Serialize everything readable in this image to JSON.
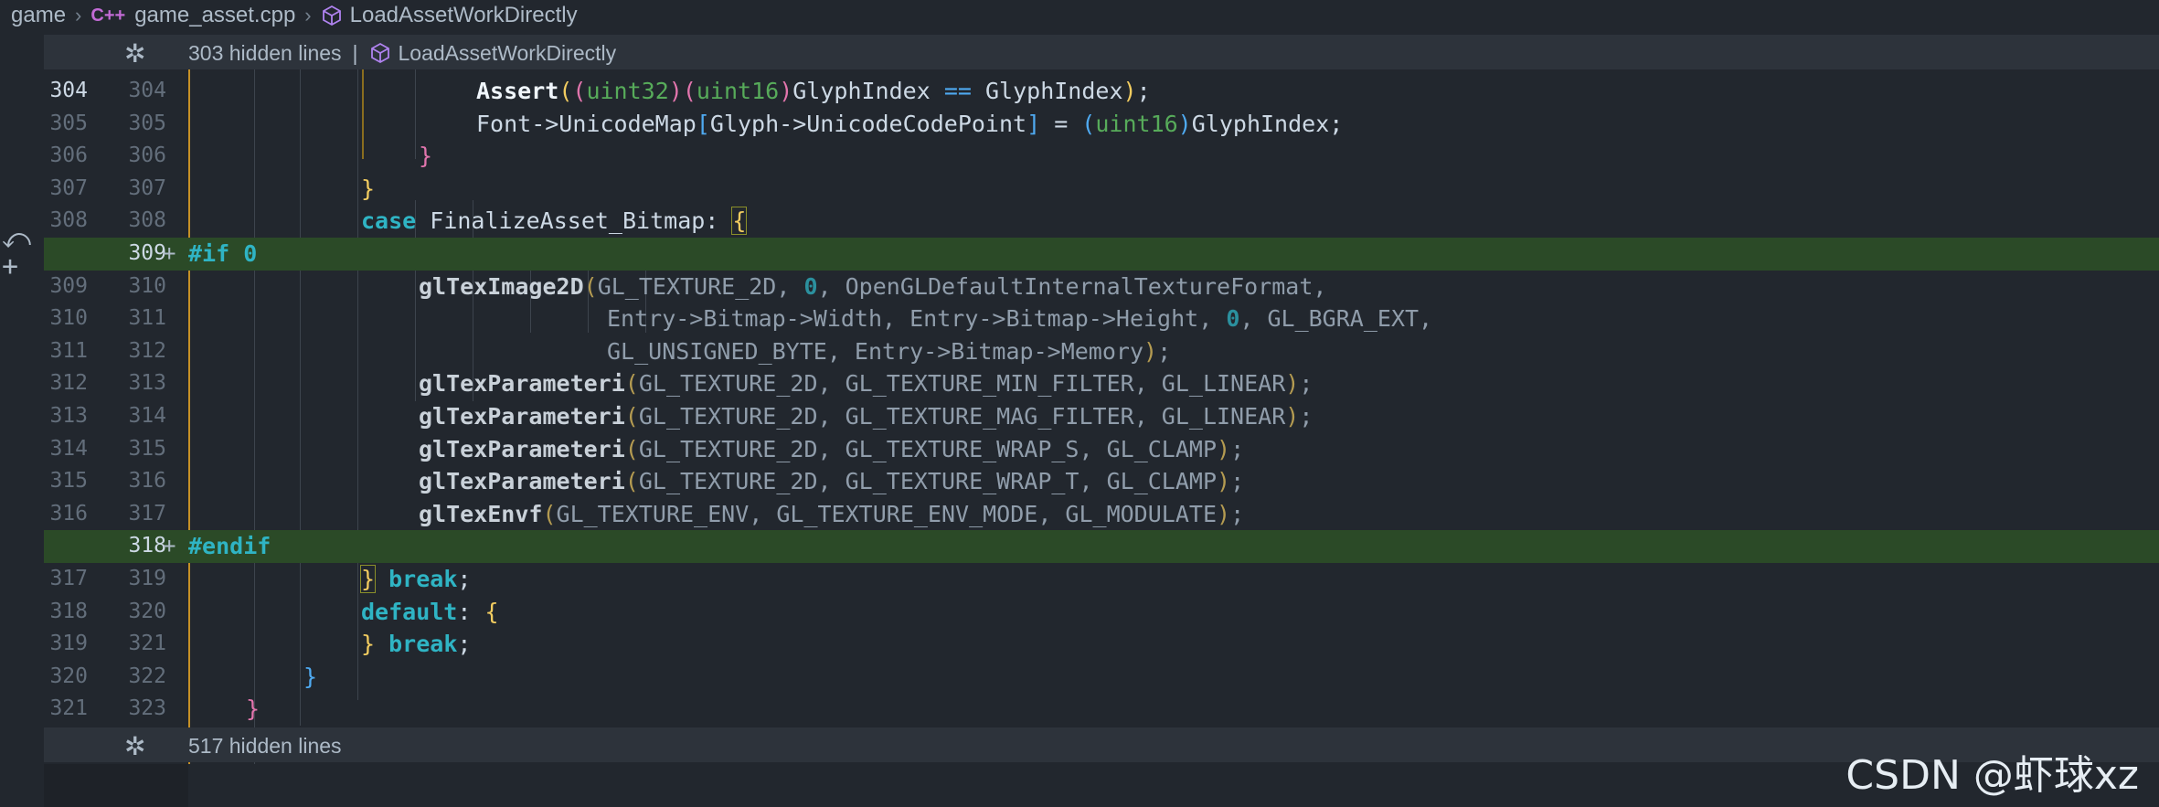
{
  "breadcrumb": {
    "items": [
      "game",
      "game_asset.cpp",
      "LoadAssetWorkDirectly"
    ],
    "file_badge": "C++"
  },
  "hidden_top": {
    "label": "303 hidden lines",
    "symbol": "LoadAssetWorkDirectly"
  },
  "hidden_bottom": {
    "label": "517 hidden lines"
  },
  "lines": [
    {
      "old": "304",
      "new": "304"
    },
    {
      "old": "305",
      "new": "305"
    },
    {
      "old": "306",
      "new": "306"
    },
    {
      "old": "307",
      "new": "307"
    },
    {
      "old": "308",
      "new": "308"
    },
    {
      "old": "",
      "new": "309",
      "added": true
    },
    {
      "old": "309",
      "new": "310"
    },
    {
      "old": "310",
      "new": "311"
    },
    {
      "old": "311",
      "new": "312"
    },
    {
      "old": "312",
      "new": "313"
    },
    {
      "old": "313",
      "new": "314"
    },
    {
      "old": "314",
      "new": "315"
    },
    {
      "old": "315",
      "new": "316"
    },
    {
      "old": "316",
      "new": "317"
    },
    {
      "old": "",
      "new": "318",
      "added": true
    },
    {
      "old": "317",
      "new": "319"
    },
    {
      "old": "318",
      "new": "320"
    },
    {
      "old": "319",
      "new": "321"
    },
    {
      "old": "320",
      "new": "322"
    },
    {
      "old": "321",
      "new": "323"
    }
  ],
  "code": {
    "l304": {
      "assert": "Assert",
      "p1": "(",
      "p2": "(",
      "t1": "uint32",
      "p3": ")",
      "p4": "(",
      "t2": "uint16",
      "p5": ")",
      "a": "GlyphIndex ",
      "eq": "==",
      "b": " GlyphIndex",
      "p6": ")",
      ";": ";"
    },
    "l305": {
      "a": "Font->UnicodeMap",
      "lb": "[",
      "b": "Glyph->UnicodeCodePoint",
      "rb": "]",
      "c": " = ",
      "p1": "(",
      "t": "uint16",
      "p2": ")",
      "d": "GlyphIndex;"
    },
    "l306": {
      "brace": "}"
    },
    "l307": {
      "brace": "}"
    },
    "l308": {
      "kw": "case",
      "a": " FinalizeAsset_Bitmap: ",
      "brace": "{"
    },
    "l309": {
      "pre": "#if",
      "num": "0"
    },
    "l310": {
      "fn": "glTexImage2D",
      "p": "(",
      "a": "GL_TEXTURE_2D, ",
      "n": "0",
      "b": ", OpenGLDefaultInternalTextureFormat,"
    },
    "l311": {
      "a": "Entry->Bitmap->Width, Entry->Bitmap->Height, ",
      "n": "0",
      "b": ", GL_BGRA_EXT,"
    },
    "l312": {
      "a": "GL_UNSIGNED_BYTE, Entry->Bitmap->Memory",
      "p": ")",
      "b": ";"
    },
    "l313": {
      "fn": "glTexParameteri",
      "p": "(",
      "a": "GL_TEXTURE_2D, GL_TEXTURE_MIN_FILTER, GL_LINEAR",
      "q": ")",
      "b": ";"
    },
    "l314": {
      "fn": "glTexParameteri",
      "p": "(",
      "a": "GL_TEXTURE_2D, GL_TEXTURE_MAG_FILTER, GL_LINEAR",
      "q": ")",
      "b": ";"
    },
    "l315": {
      "fn": "glTexParameteri",
      "p": "(",
      "a": "GL_TEXTURE_2D, GL_TEXTURE_WRAP_S, GL_CLAMP",
      "q": ")",
      "b": ";"
    },
    "l316": {
      "fn": "glTexParameteri",
      "p": "(",
      "a": "GL_TEXTURE_2D, GL_TEXTURE_WRAP_T, GL_CLAMP",
      "q": ")",
      "b": ";"
    },
    "l317": {
      "fn": "glTexEnvf",
      "p": "(",
      "a": "GL_TEXTURE_ENV, GL_TEXTURE_ENV_MODE, GL_MODULATE",
      "q": ")",
      "b": ";"
    },
    "l318": {
      "pre": "#endif"
    },
    "l319": {
      "brace": "}",
      "kw": "break",
      ";": ";"
    },
    "l320": {
      "kw": "default",
      "a": ": ",
      "brace": "{"
    },
    "l321": {
      "brace": "}",
      "kw": "break",
      ";": ";"
    },
    "l322": {
      "brace": "}"
    },
    "l323": {
      "brace": "}"
    }
  },
  "watermark": "CSDN @虾球xz",
  "colors": {
    "background": "#22272e",
    "added_line": "#2b4a27",
    "keyword": "#2fb4c4",
    "type": "#57ab5a",
    "modified_bar": "#c69026"
  }
}
